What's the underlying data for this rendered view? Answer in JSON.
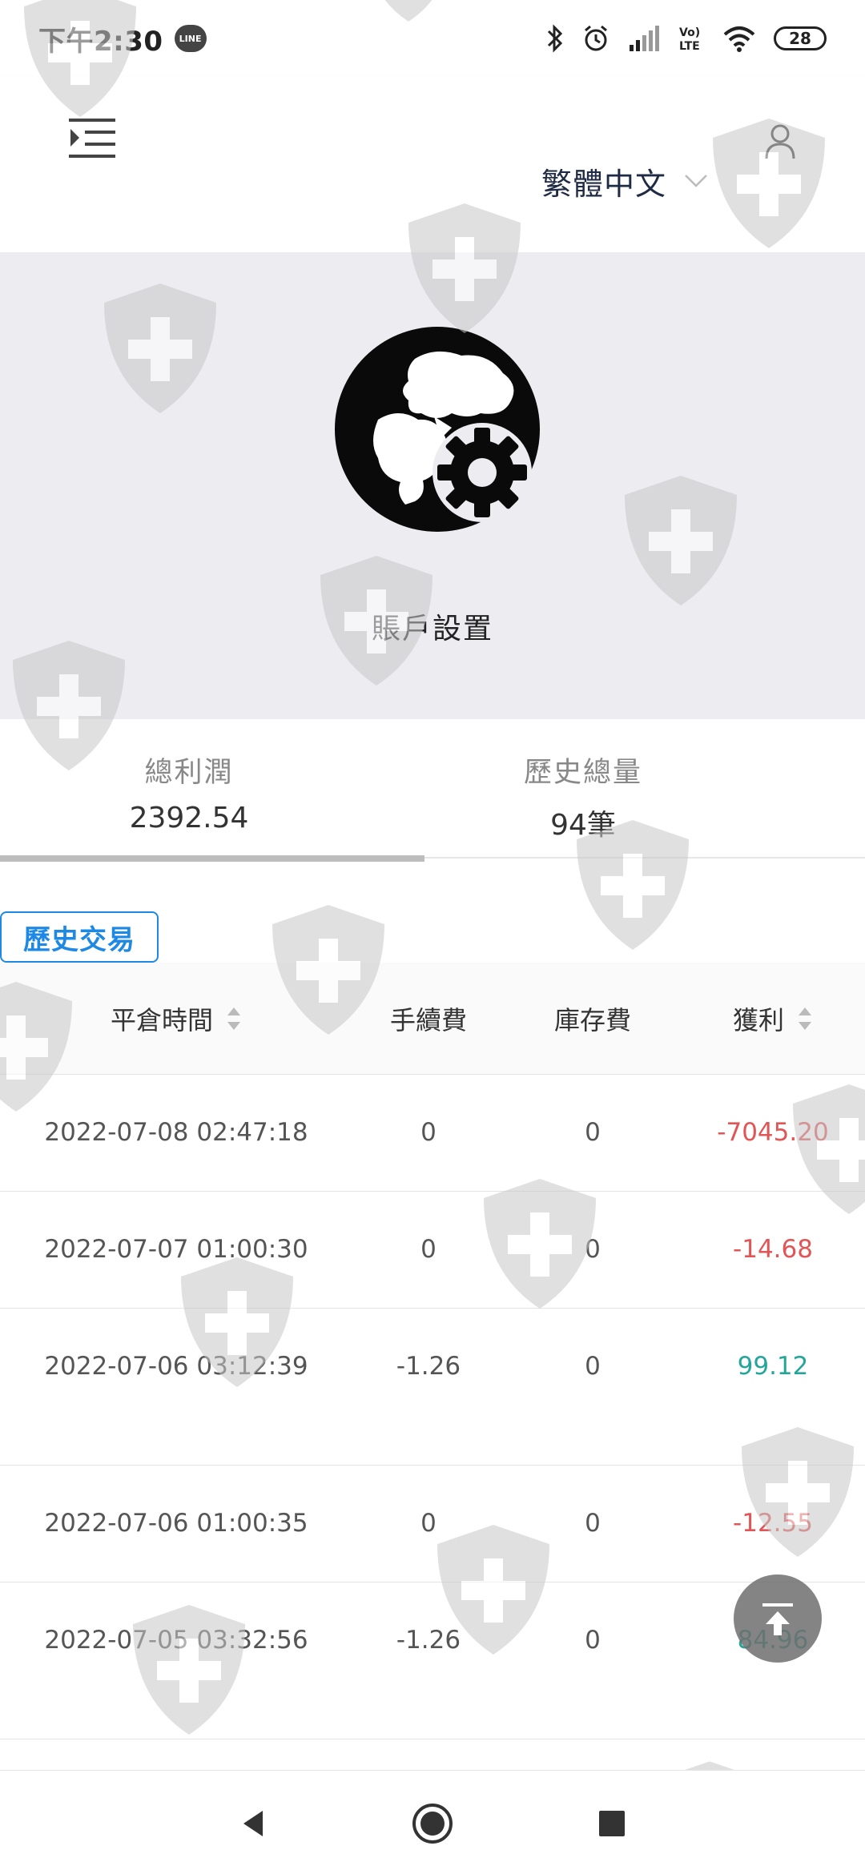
{
  "status_bar": {
    "time": "下午2:30",
    "line_badge": "LINE",
    "battery": "28",
    "icons": [
      "bluetooth-icon",
      "alarm-icon",
      "signal-icon",
      "volte-icon",
      "wifi-icon",
      "battery-icon"
    ]
  },
  "header": {
    "menu_icon": "indent-menu-icon",
    "language": "繁體中文",
    "user_icon": "user-icon"
  },
  "hero": {
    "title": "賬戶設置"
  },
  "stats": {
    "total_profit_label": "總利潤",
    "total_profit_value": "2392.54",
    "history_total_label": "歷史總量",
    "history_total_value": "94筆"
  },
  "history": {
    "tag": "歷史交易",
    "columns": {
      "close_time": "平倉時間",
      "fee": "手續費",
      "storage": "庫存費",
      "profit": "獲利"
    },
    "rows": [
      {
        "time": "2022-07-08 02:47:18",
        "fee": "0",
        "storage": "0",
        "profit": "-7045.20",
        "sign": "neg"
      },
      {
        "time": "2022-07-07 01:00:30",
        "fee": "0",
        "storage": "0",
        "profit": "-14.68",
        "sign": "neg"
      },
      {
        "time": "2022-07-06 03:12:39",
        "fee": "-1.26",
        "storage": "0",
        "profit": "99.12",
        "sign": "pos"
      },
      {
        "time": "2022-07-06 01:00:35",
        "fee": "0",
        "storage": "0",
        "profit": "-12.55",
        "sign": "neg"
      },
      {
        "time": "2022-07-05 03:32:56",
        "fee": "-1.26",
        "storage": "0",
        "profit": "84.96",
        "sign": "pos"
      }
    ]
  },
  "colors": {
    "negative": "#e05555",
    "positive": "#26a69a",
    "accent": "#1e88e5",
    "hero_bg": "#ececf1"
  }
}
